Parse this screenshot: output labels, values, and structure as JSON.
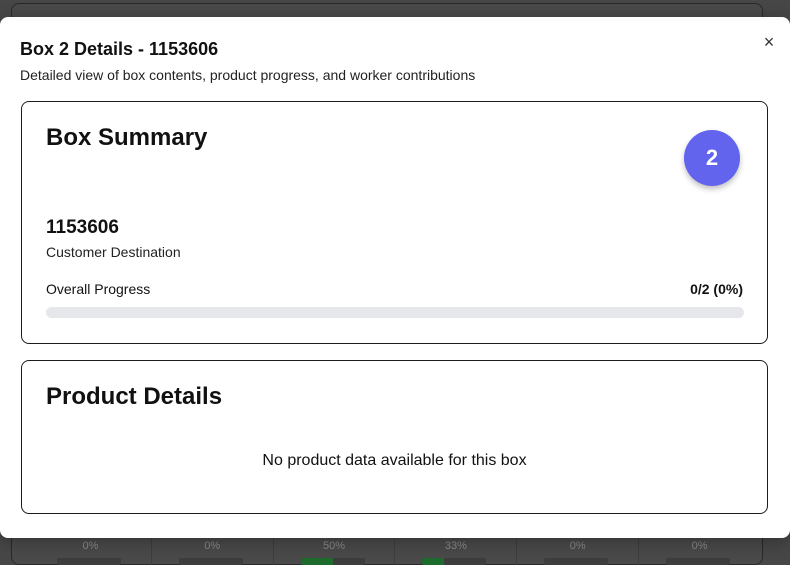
{
  "background": {
    "stats": [
      {
        "label": "0%",
        "progress": 0
      },
      {
        "label": "0%",
        "progress": 0
      },
      {
        "label": "50%",
        "progress": 0.5
      },
      {
        "label": "33%",
        "progress": 0.33
      },
      {
        "label": "0%",
        "progress": 0
      },
      {
        "label": "0%",
        "progress": 0
      }
    ]
  },
  "modal": {
    "title": "Box 2 Details - 1153606",
    "subtitle": "Detailed view of box contents, product progress, and worker contributions",
    "close_icon": "×"
  },
  "summary": {
    "title": "Box Summary",
    "badge": "2",
    "box_number": "1153606",
    "destination": "Customer Destination",
    "progress_label": "Overall Progress",
    "progress_value": "0/2 (0%)",
    "progress_fraction": 0
  },
  "products": {
    "title": "Product Details",
    "empty_message": "No product data available for this box"
  },
  "colors": {
    "accent": "#6264ee",
    "progress_track": "#e5e7ea",
    "background_fill": "#1e6b2e"
  }
}
